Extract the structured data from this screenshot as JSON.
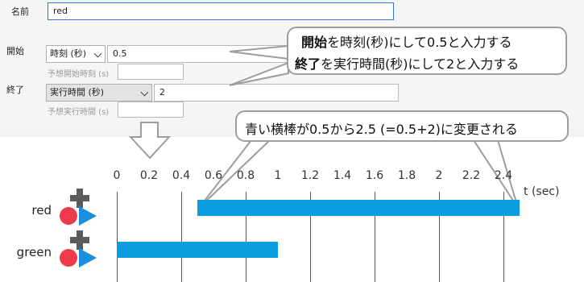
{
  "form": {
    "name_label": "名前",
    "name_value": "red",
    "start_label": "開始",
    "start_type": "時刻 (秒)",
    "start_value": "0.5",
    "start_hint": "予想開始時刻 (s)",
    "end_label": "終了",
    "end_type": "実行時間 (秒)",
    "end_value": "2",
    "end_hint": "予想実行時間 (s)"
  },
  "callout1": {
    "line1_bold": "開始",
    "line1_rest": "を時刻(秒)にして0.5と入力する",
    "line2_bold": "終了",
    "line2_rest": "を実行時間(秒)にして2と入力する"
  },
  "callout2": {
    "text": "青い横棒が0.5から2.5 (=0.5+2)に変更される"
  },
  "chart_data": {
    "type": "bar",
    "xlabel": "t (sec)",
    "ticks": [
      "0",
      "0.2",
      "0.4",
      "0.6",
      "0.8",
      "1",
      "1.2",
      "1.4",
      "1.6",
      "1.8",
      "2",
      "2.2",
      "2.4"
    ],
    "xlim": [
      0,
      2.5
    ],
    "series": [
      {
        "name": "red",
        "start": 0.5,
        "end": 2.5
      },
      {
        "name": "green",
        "start": 0,
        "end": 1
      }
    ],
    "bar_color": "#0b9de0"
  },
  "colors": {
    "icon_red": "#ee3b4c",
    "icon_blue": "#1a8fe0",
    "icon_gray": "#5b5b5b"
  }
}
